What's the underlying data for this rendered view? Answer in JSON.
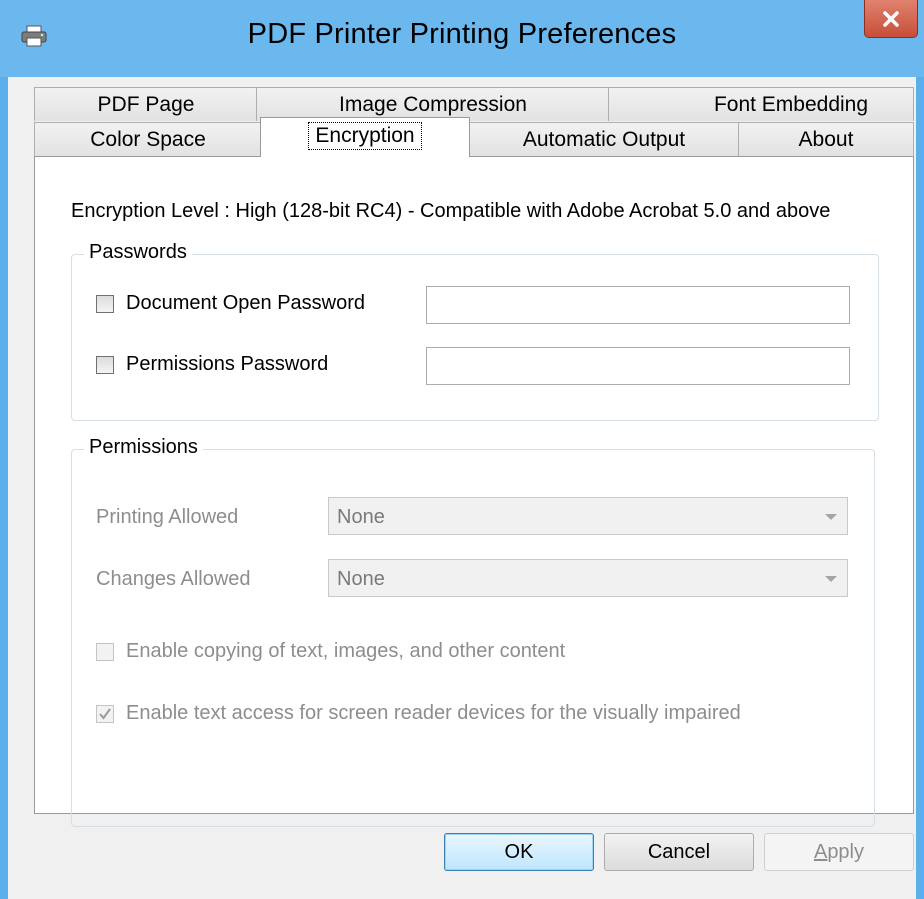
{
  "window": {
    "title": "PDF Printer Printing Preferences",
    "close_label": "X"
  },
  "tabs": {
    "row1": [
      {
        "label": "PDF Page"
      },
      {
        "label": "Image Compression"
      },
      {
        "label": "Font Embedding"
      }
    ],
    "row2": [
      {
        "label": "Color Space"
      },
      {
        "label": "Encryption",
        "selected": true
      },
      {
        "label": "Automatic Output"
      },
      {
        "label": "About"
      }
    ]
  },
  "encryption": {
    "level_text": "Encryption Level : High (128-bit RC4) - Compatible with Adobe Acrobat 5.0 and above"
  },
  "passwords": {
    "title": "Passwords",
    "document_open": {
      "label": "Document Open Password",
      "checked": false,
      "value": ""
    },
    "permissions": {
      "label": "Permissions Password",
      "checked": false,
      "value": ""
    }
  },
  "permissions": {
    "title": "Permissions",
    "printing": {
      "label": "Printing Allowed",
      "value": "None"
    },
    "changes": {
      "label": "Changes Allowed",
      "value": "None"
    },
    "copying": {
      "label": "Enable copying of text, images, and other content",
      "checked": false
    },
    "screen_reader": {
      "label": "Enable text access for screen reader devices for the visually impaired",
      "checked": true
    }
  },
  "buttons": {
    "ok": "OK",
    "cancel": "Cancel",
    "apply": "Apply"
  },
  "colors": {
    "title_bar": "#6ab8ee",
    "close_button": "#c74f38",
    "dialog_bg": "#f0f0f0",
    "disabled_text": "#8d8d8d"
  }
}
